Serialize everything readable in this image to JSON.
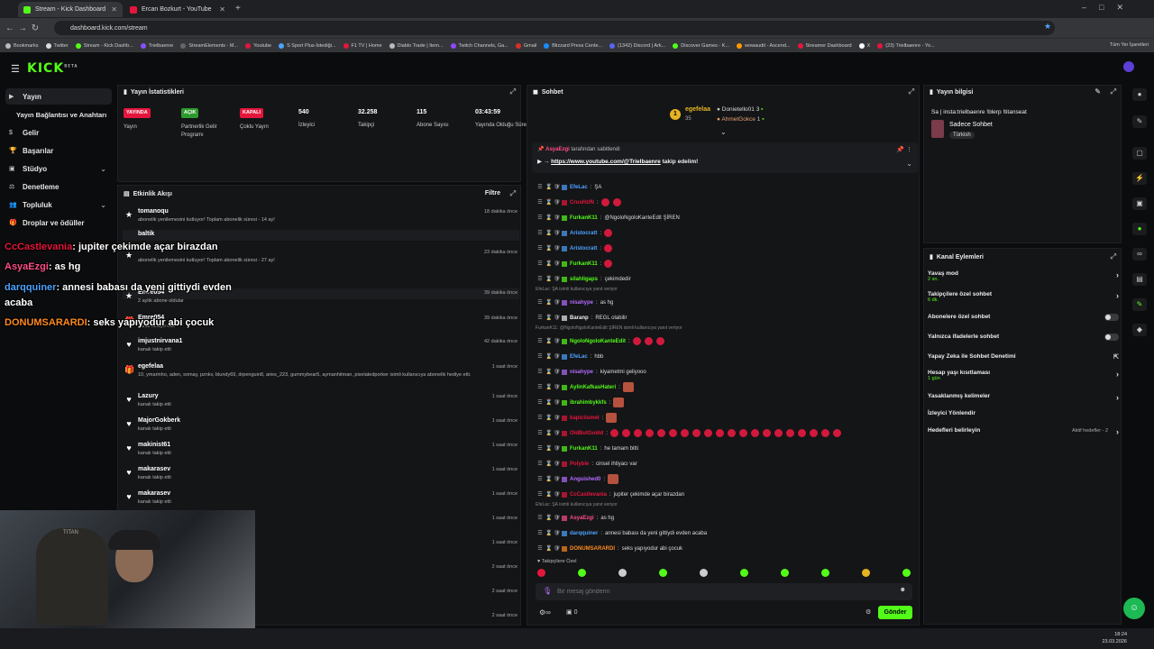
{
  "browser": {
    "tabs": [
      {
        "label": "Stream - Kick Dashboard"
      },
      {
        "label": "Ercan Bozkurt - YouTube"
      }
    ],
    "url": "dashboard.kick.com/stream",
    "bookmarks": [
      "Bookmarks",
      "Twitter",
      "Stream - Kick Dashb...",
      "Trielbaenre",
      "StreamElements - M...",
      "Youtube",
      "S Sport Plus-İstediği...",
      "F1 TV | Home",
      "Diablo Trade | Item...",
      "Twitch Channels, Ga...",
      "Gmail",
      "Blizzard Press Cente...",
      "(1342) Discord | Ark...",
      "Discover Games - K...",
      "wowaudit - Ascend...",
      "Streamer Dashboard",
      "X",
      "(23) Trielbaenre - Yo..."
    ],
    "all_bookmarks": "Tüm Yer İşaretleri"
  },
  "app": {
    "logo": "KICK",
    "beta": "BETA"
  },
  "sidebar": {
    "items": [
      {
        "label": "Yayın"
      },
      {
        "label": "Yayın Bağlantısı ve Anahtarı"
      },
      {
        "label": "Gelir"
      },
      {
        "label": "Başarılar"
      },
      {
        "label": "Stüdyo"
      },
      {
        "label": "Denetleme"
      },
      {
        "label": "Topluluk"
      },
      {
        "label": "Droplar ve ödüller"
      }
    ]
  },
  "stats": {
    "title": "Yayın İstatistikleri",
    "items": [
      {
        "badge": "YAYINDA",
        "label": "Yayın",
        "color": "#e5163c"
      },
      {
        "badge": "AÇIK",
        "label": "Partnerlik Gelir Programı",
        "color": "#2e9a2e"
      },
      {
        "badge": "KAPALI",
        "label": "Çoklu Yayın",
        "color": "#e5163c"
      },
      {
        "value": "540",
        "label": "İzleyici"
      },
      {
        "value": "32.258",
        "label": "Takipçi"
      },
      {
        "value": "115",
        "label": "Abone Sayısı"
      },
      {
        "value": "03:43:59",
        "label": "Yayında Olduğu Süre"
      }
    ]
  },
  "activity": {
    "title": "Etkinlik Akışı",
    "filter": "Filtre",
    "items": [
      {
        "name": "tomanoqu",
        "sub": "abonelik yenilemesini kutluyor! Toplam abonelik süresi - 14 ay!",
        "time": "18 dakika önce",
        "icon": "star"
      },
      {
        "name": "baltik",
        "sub": "",
        "time": "",
        "icon": ""
      },
      {
        "name": "",
        "sub": "abonelik yenilemesini kutluyor! Toplam abonelik süresi - 27 ay!",
        "time": "23 dakika önce",
        "icon": "star"
      },
      {
        "name": "Emre054",
        "sub": "2 aylık abone oldular",
        "time": "39 dakika önce",
        "icon": "star"
      },
      {
        "name": "Emre054",
        "sub": "kanal hediye etti.",
        "time": "39 dakika önce",
        "icon": "gift"
      },
      {
        "name": "imjustnirvana1",
        "sub": "kanalı takip etti",
        "time": "42 dakika önce",
        "icon": "heart"
      },
      {
        "name": "egefelaa",
        "sub": "10, ymarinho, aden, somay, pznkv, blundy69, drpenguin8, aries_223, gummybear5, aymanhitman, pixelatedporker isimli kullanıcıya abonelik hediye etti.",
        "time": "1 saat önce",
        "icon": "gift"
      },
      {
        "name": "Lazury",
        "sub": "kanalı takip etti",
        "time": "1 saat önce",
        "icon": "heart"
      },
      {
        "name": "MajorGokberk",
        "sub": "kanalı takip etti",
        "time": "1 saat önce",
        "icon": "heart"
      },
      {
        "name": "makinist61",
        "sub": "kanalı takip etti",
        "time": "1 saat önce",
        "icon": "heart"
      },
      {
        "name": "makarasev",
        "sub": "kanalı takip etti",
        "time": "1 saat önce",
        "icon": "heart"
      },
      {
        "name": "makarasev",
        "sub": "kanalı takip etti",
        "time": "1 saat önce",
        "icon": "heart"
      },
      {
        "name": "",
        "sub": "",
        "time": "1 saat önce",
        "icon": ""
      },
      {
        "name": "",
        "sub": "",
        "time": "1 saat önce",
        "icon": ""
      },
      {
        "name": "",
        "sub": "",
        "time": "2 saat önce",
        "icon": ""
      },
      {
        "name": "",
        "sub": "",
        "time": "2 saat önce",
        "icon": ""
      },
      {
        "name": "",
        "sub": "",
        "time": "2 saat önce",
        "icon": ""
      }
    ]
  },
  "chat": {
    "title": "Sohbet",
    "leaders": {
      "top": "egefelaa",
      "top_count": "35",
      "second": "Donietello01",
      "second_count": "3",
      "third": "AhmetGokce",
      "third_count": "1"
    },
    "pinned": {
      "by": "AsyaEzgi",
      "by_suffix": "tarafından sabitlendi",
      "link": "https://www.youtube.com/@Trielbaenre",
      "link_suffix": "takip edelim!"
    },
    "messages": [
      {
        "user": "EfeLac",
        "color": "#4da3ff",
        "text": "ŞA",
        "emotes": 0
      },
      {
        "user": "CrusHzIN",
        "color": "#e5163c",
        "text": "",
        "emotes": 2
      },
      {
        "user": "FurkanK11",
        "color": "#53fc18",
        "text": "@NgoloNgoloKanteEdit ŞİREN",
        "emotes": 0
      },
      {
        "user": "Aristocratt",
        "color": "#4da3ff",
        "text": "",
        "emotes": 1
      },
      {
        "user": "Aristocratt",
        "color": "#4da3ff",
        "text": "",
        "emotes": 1
      },
      {
        "user": "FurkanK11",
        "color": "#53fc18",
        "text": "",
        "emotes": 1
      },
      {
        "user": "silahligaps",
        "color": "#53fc18",
        "text": "çekimdedir",
        "emotes": 0
      },
      {
        "reply": "EfeLac: ŞA isimli kullanıcıya yanıt veriyor"
      },
      {
        "user": "nisahype",
        "color": "#b36bff",
        "text": "as hg",
        "emotes": 0
      },
      {
        "user": "Baranp",
        "color": "#eeeeee",
        "text": "REGL olabilir",
        "emotes": 0
      },
      {
        "reply": "FurkanK11: @NgoloNgoloKanteEdit ŞİREN isimli kullanıcıya yanıt veriyor"
      },
      {
        "user": "NgoloNgoloKanteEdit",
        "color": "#53fc18",
        "text": "",
        "emotes": 3
      },
      {
        "user": "EfeLac",
        "color": "#4da3ff",
        "text": "hbb",
        "emotes": 0
      },
      {
        "user": "nisahype",
        "color": "#b36bff",
        "text": "kiyametmi geliyooo",
        "emotes": 0
      },
      {
        "user": "AylinKafkasHateri",
        "color": "#53fc18",
        "text": "",
        "emotes": 1,
        "sq": true
      },
      {
        "user": "ibrahimbykkfs",
        "color": "#53fc18",
        "text": "",
        "emotes": 1,
        "sq": true
      },
      {
        "user": "kapiciismet",
        "color": "#e5163c",
        "text": "",
        "emotes": 1,
        "sq": true
      },
      {
        "user": "OldButGoldd",
        "color": "#e5163c",
        "text": "",
        "emotes": 20
      },
      {
        "user": "FurkanK11",
        "color": "#53fc18",
        "text": "he tamam bitti",
        "emotes": 0
      },
      {
        "user": "Polyble",
        "color": "#e5163c",
        "text": "cinsel ihtiyacı var",
        "emotes": 0
      },
      {
        "user": "Anguished0",
        "color": "#b36bff",
        "text": "",
        "emotes": 1,
        "sq": true
      },
      {
        "user": "CcCastlevania",
        "color": "#e5163c",
        "text": "jupiter çekimde açar birazdan",
        "emotes": 0
      },
      {
        "reply": "EfeLac: ŞA isimli kullanıcıya yanıt veriyor"
      },
      {
        "user": "AsyaEzgi",
        "color": "#ff4d88",
        "text": "as hg",
        "emotes": 0
      },
      {
        "user": "darqquiner",
        "color": "#4da3ff",
        "text": "annesi babası da yeni gittiydi evden acaba",
        "emotes": 0
      },
      {
        "user": "DONUMSARARDI",
        "color": "#ff8a1f",
        "text": "seks yapıyodur abi çocuk",
        "emotes": 0
      }
    ],
    "followers_only": "Takipçilere Özel",
    "input_placeholder": "Bir mesaj gönderin",
    "viewer_count": "0",
    "send": "Gönder"
  },
  "overlay": [
    {
      "user": "CcCastlevania",
      "text": ": jupiter çekimde açar birazdan",
      "color": "#e5163c"
    },
    {
      "user": "AsyaEzgi",
      "text": ": as hg",
      "color": "#ff4d88"
    },
    {
      "user": "darqquiner",
      "text": ": annesi babası da yeni gittiydi evden",
      "color": "#4da3ff"
    },
    {
      "user": "",
      "text": "acaba",
      "color": "#ffffff"
    },
    {
      "user": "DONUMSARARDI",
      "text": ": seks yapıyodur abi çocuk",
      "color": "#ff8a1f"
    }
  ],
  "stream_info": {
    "title": "Yayın bilgisi",
    "stream_title": "Sa | insta:trielbaenre !blerp !titanseat",
    "category": "Sadece Sohbet",
    "tag": "Türkish"
  },
  "channel_actions": {
    "title": "Kanal Eylemleri",
    "items": [
      {
        "label": "Yavaş mod",
        "sub": "2 sn.",
        "ctrl": "chev"
      },
      {
        "label": "Takipçilere özel sohbet",
        "sub": "6 dk.",
        "ctrl": "chev"
      },
      {
        "label": "Abonelere özel sohbet",
        "sub": "",
        "ctrl": "toggle"
      },
      {
        "label": "Yalnızca ifadelerle sohbet",
        "sub": "",
        "ctrl": "toggle"
      },
      {
        "label": "Yapay Zeka ile Sohbet Denetimi",
        "sub": "",
        "ctrl": "ext"
      },
      {
        "label": "Hesap yaşı kısıtlaması",
        "sub": "1 gün",
        "ctrl": "chev"
      },
      {
        "label": "Yasaklanmış kelimeler",
        "sub": "",
        "ctrl": "chev"
      },
      {
        "label": "İzleyici Yönlendir",
        "sub": "",
        "ctrl": ""
      },
      {
        "label": "Hedefleri belirleyin",
        "sub": "",
        "ctrl": "chev",
        "extra": "Aktif hedefler - 2"
      }
    ]
  },
  "taskbar": {
    "time": "18:24",
    "date": "23.03.2026"
  },
  "colors": {
    "accent": "#53fc18",
    "live": "#e5163c"
  }
}
